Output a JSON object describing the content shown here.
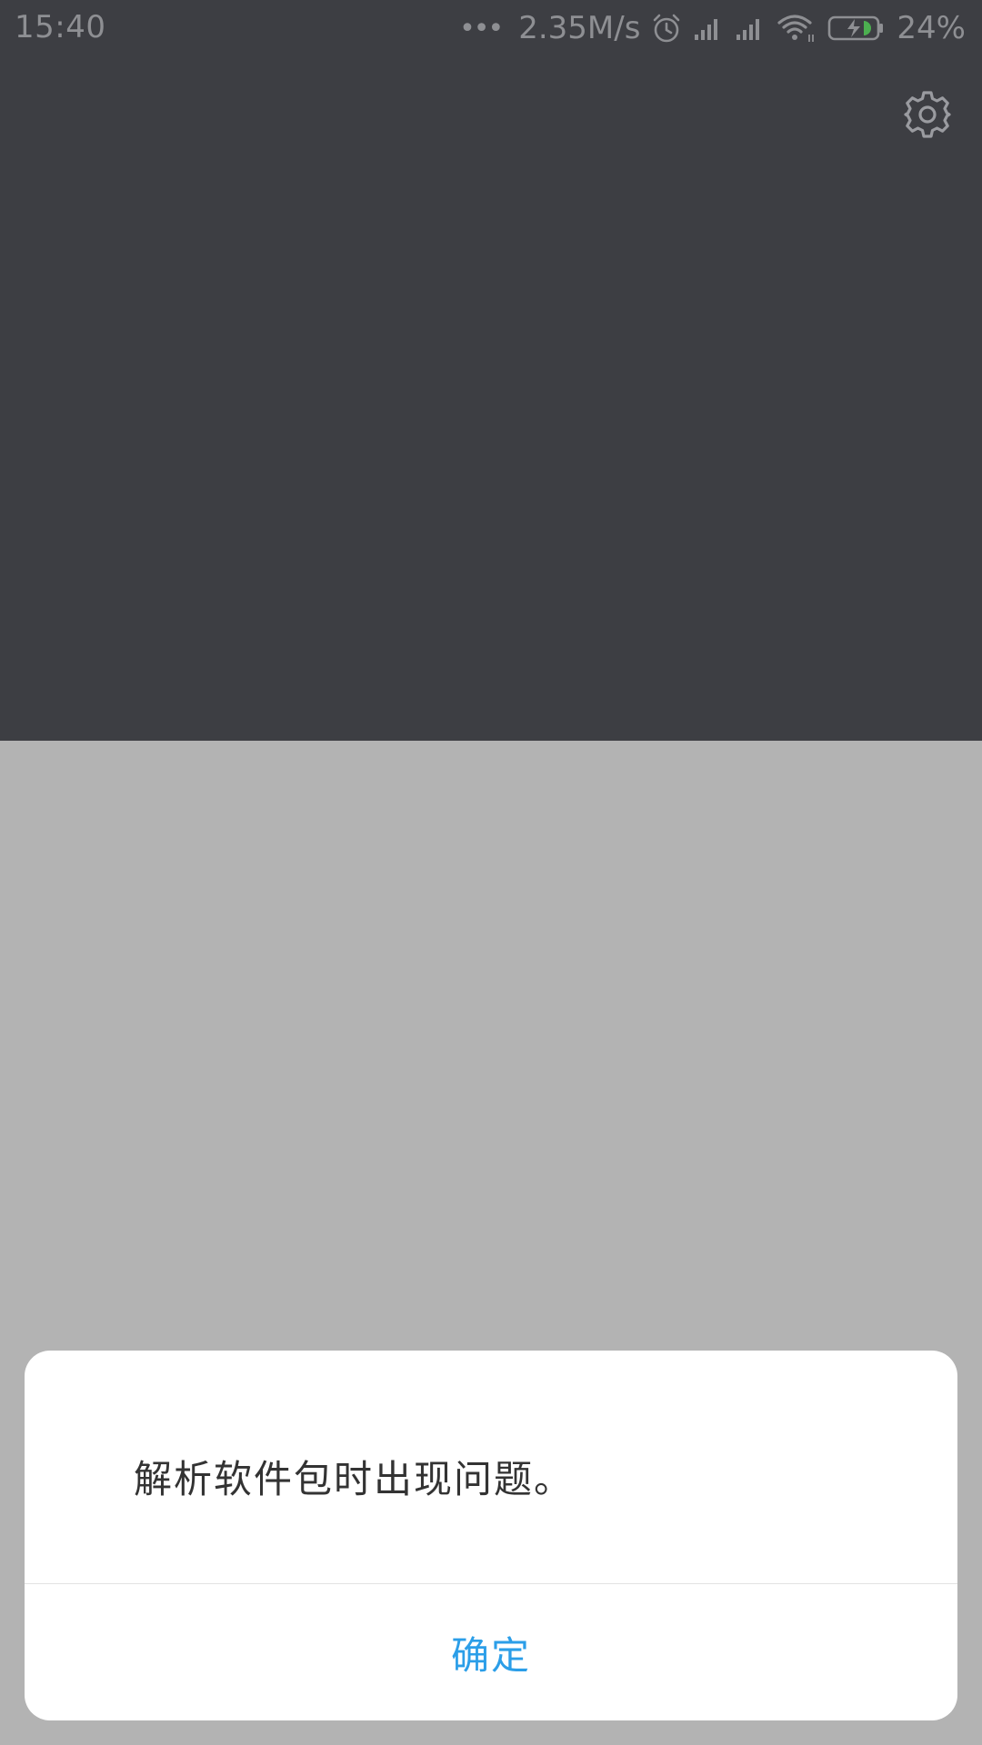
{
  "status_bar": {
    "time": "15:40",
    "more_indicator": "•••",
    "network_speed": "2.35M/s",
    "battery_percent": "24%",
    "icons": [
      "alarm-icon",
      "signal-icon",
      "signal-icon",
      "wifi-icon",
      "battery-charging-icon"
    ],
    "battery_level": 0.24,
    "battery_fill_color": "#4caf50"
  },
  "toolbar": {
    "settings_icon": "gear-icon"
  },
  "dialog": {
    "message": "解析软件包时出现问题。",
    "confirm_label": "确定"
  },
  "colors": {
    "top_background": "#3d3e43",
    "scrim": "#b3b3b3",
    "accent": "#2b9ee8",
    "status_text": "#8e8f93"
  }
}
